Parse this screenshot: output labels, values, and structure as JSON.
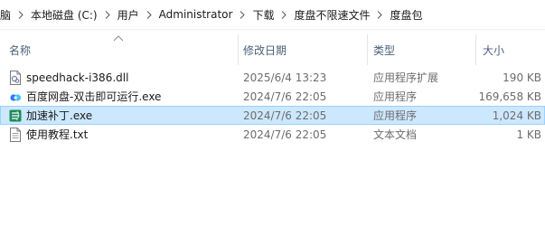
{
  "breadcrumb": [
    "脑",
    "本地磁盘 (C:)",
    "用户",
    "Administrator",
    "下载",
    "度盘不限速文件",
    "度盘包"
  ],
  "columns": {
    "name": "名称",
    "date": "修改日期",
    "type": "类型",
    "size": "大小"
  },
  "files": [
    {
      "name": "speedhack-i386.dll",
      "date": "2025/6/4 13:23",
      "type": "应用程序扩展",
      "size": "190 KB",
      "icon": "dll-file-icon"
    },
    {
      "name": "百度网盘-双击即可运行.exe",
      "date": "2024/7/6 22:05",
      "type": "应用程序",
      "size": "169,658 KB",
      "icon": "baidu-netdisk-icon"
    },
    {
      "name": "加速补丁.exe",
      "date": "2024/7/6 22:05",
      "type": "应用程序",
      "size": "1,024 KB",
      "icon": "speed-patch-icon",
      "selected": true
    },
    {
      "name": "使用教程.txt",
      "date": "2024/7/6 22:05",
      "type": "文本文档",
      "size": "1 KB",
      "icon": "text-file-icon"
    }
  ],
  "colors": {
    "selection": "#cce8ff",
    "selection_border": "#99d1ff",
    "header_text": "#4c607a"
  }
}
